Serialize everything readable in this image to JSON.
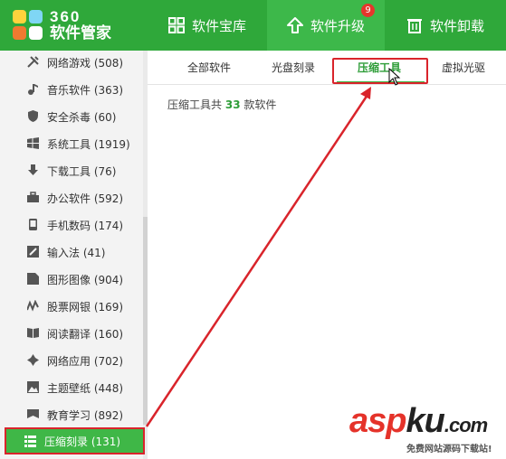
{
  "header": {
    "logo_line1": "360",
    "logo_line2": "软件管家",
    "nav": [
      {
        "label": "软件宝库"
      },
      {
        "label": "软件升级",
        "badge": "9"
      },
      {
        "label": "软件卸载"
      }
    ],
    "colors": {
      "bar": "#2fa83a",
      "active": "#3db84a",
      "badge": "#e6362c"
    }
  },
  "sidebar": {
    "items": [
      {
        "label": "网络游戏 (508)",
        "icon": "tools-icon"
      },
      {
        "label": "音乐软件 (363)",
        "icon": "music-note-icon"
      },
      {
        "label": "安全杀毒 (60)",
        "icon": "shield-icon"
      },
      {
        "label": "系统工具 (1919)",
        "icon": "windows-icon"
      },
      {
        "label": "下载工具 (76)",
        "icon": "download-arrow-icon"
      },
      {
        "label": "办公软件 (592)",
        "icon": "briefcase-icon"
      },
      {
        "label": "手机数码 (174)",
        "icon": "phone-icon"
      },
      {
        "label": "输入法 (41)",
        "icon": "pen-icon"
      },
      {
        "label": "图形图像 (904)",
        "icon": "image-icon"
      },
      {
        "label": "股票网银 (169)",
        "icon": "chart-line-icon"
      },
      {
        "label": "阅读翻译 (160)",
        "icon": "book-icon"
      },
      {
        "label": "网络应用 (702)",
        "icon": "network-icon"
      },
      {
        "label": "主题壁纸 (448)",
        "icon": "wallpaper-icon"
      },
      {
        "label": "教育学习 (892)",
        "icon": "flag-icon"
      },
      {
        "label": "压缩刻录 (131)",
        "icon": "list-icon",
        "active": true
      }
    ]
  },
  "tabs": [
    {
      "label": "全部软件"
    },
    {
      "label": "光盘刻录"
    },
    {
      "label": "压缩工具",
      "active": true
    },
    {
      "label": "虚拟光驱"
    }
  ],
  "summary": {
    "prefix": "压缩工具共",
    "count": "33",
    "suffix": "款软件"
  },
  "watermark": {
    "part1": "asp",
    "part2": "ku",
    "suffix": ".com",
    "sub": "免费网站源码下载站!"
  },
  "annotation_color": "#d9242b"
}
